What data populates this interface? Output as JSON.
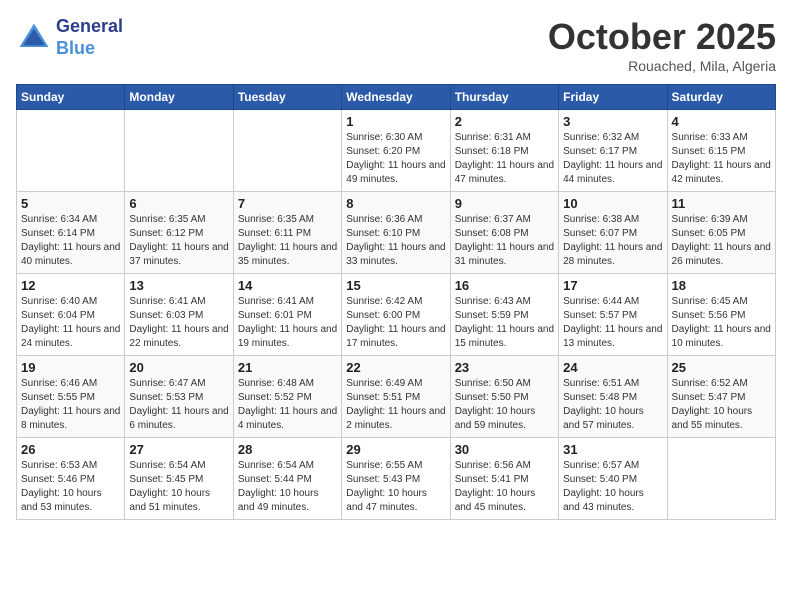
{
  "header": {
    "logo_line1": "General",
    "logo_line2": "Blue",
    "month": "October 2025",
    "location": "Rouached, Mila, Algeria"
  },
  "weekdays": [
    "Sunday",
    "Monday",
    "Tuesday",
    "Wednesday",
    "Thursday",
    "Friday",
    "Saturday"
  ],
  "weeks": [
    [
      {
        "day": "",
        "info": ""
      },
      {
        "day": "",
        "info": ""
      },
      {
        "day": "",
        "info": ""
      },
      {
        "day": "1",
        "info": "Sunrise: 6:30 AM\nSunset: 6:20 PM\nDaylight: 11 hours\nand 49 minutes."
      },
      {
        "day": "2",
        "info": "Sunrise: 6:31 AM\nSunset: 6:18 PM\nDaylight: 11 hours\nand 47 minutes."
      },
      {
        "day": "3",
        "info": "Sunrise: 6:32 AM\nSunset: 6:17 PM\nDaylight: 11 hours\nand 44 minutes."
      },
      {
        "day": "4",
        "info": "Sunrise: 6:33 AM\nSunset: 6:15 PM\nDaylight: 11 hours\nand 42 minutes."
      }
    ],
    [
      {
        "day": "5",
        "info": "Sunrise: 6:34 AM\nSunset: 6:14 PM\nDaylight: 11 hours\nand 40 minutes."
      },
      {
        "day": "6",
        "info": "Sunrise: 6:35 AM\nSunset: 6:12 PM\nDaylight: 11 hours\nand 37 minutes."
      },
      {
        "day": "7",
        "info": "Sunrise: 6:35 AM\nSunset: 6:11 PM\nDaylight: 11 hours\nand 35 minutes."
      },
      {
        "day": "8",
        "info": "Sunrise: 6:36 AM\nSunset: 6:10 PM\nDaylight: 11 hours\nand 33 minutes."
      },
      {
        "day": "9",
        "info": "Sunrise: 6:37 AM\nSunset: 6:08 PM\nDaylight: 11 hours\nand 31 minutes."
      },
      {
        "day": "10",
        "info": "Sunrise: 6:38 AM\nSunset: 6:07 PM\nDaylight: 11 hours\nand 28 minutes."
      },
      {
        "day": "11",
        "info": "Sunrise: 6:39 AM\nSunset: 6:05 PM\nDaylight: 11 hours\nand 26 minutes."
      }
    ],
    [
      {
        "day": "12",
        "info": "Sunrise: 6:40 AM\nSunset: 6:04 PM\nDaylight: 11 hours\nand 24 minutes."
      },
      {
        "day": "13",
        "info": "Sunrise: 6:41 AM\nSunset: 6:03 PM\nDaylight: 11 hours\nand 22 minutes."
      },
      {
        "day": "14",
        "info": "Sunrise: 6:41 AM\nSunset: 6:01 PM\nDaylight: 11 hours\nand 19 minutes."
      },
      {
        "day": "15",
        "info": "Sunrise: 6:42 AM\nSunset: 6:00 PM\nDaylight: 11 hours\nand 17 minutes."
      },
      {
        "day": "16",
        "info": "Sunrise: 6:43 AM\nSunset: 5:59 PM\nDaylight: 11 hours\nand 15 minutes."
      },
      {
        "day": "17",
        "info": "Sunrise: 6:44 AM\nSunset: 5:57 PM\nDaylight: 11 hours\nand 13 minutes."
      },
      {
        "day": "18",
        "info": "Sunrise: 6:45 AM\nSunset: 5:56 PM\nDaylight: 11 hours\nand 10 minutes."
      }
    ],
    [
      {
        "day": "19",
        "info": "Sunrise: 6:46 AM\nSunset: 5:55 PM\nDaylight: 11 hours\nand 8 minutes."
      },
      {
        "day": "20",
        "info": "Sunrise: 6:47 AM\nSunset: 5:53 PM\nDaylight: 11 hours\nand 6 minutes."
      },
      {
        "day": "21",
        "info": "Sunrise: 6:48 AM\nSunset: 5:52 PM\nDaylight: 11 hours\nand 4 minutes."
      },
      {
        "day": "22",
        "info": "Sunrise: 6:49 AM\nSunset: 5:51 PM\nDaylight: 11 hours\nand 2 minutes."
      },
      {
        "day": "23",
        "info": "Sunrise: 6:50 AM\nSunset: 5:50 PM\nDaylight: 10 hours\nand 59 minutes."
      },
      {
        "day": "24",
        "info": "Sunrise: 6:51 AM\nSunset: 5:48 PM\nDaylight: 10 hours\nand 57 minutes."
      },
      {
        "day": "25",
        "info": "Sunrise: 6:52 AM\nSunset: 5:47 PM\nDaylight: 10 hours\nand 55 minutes."
      }
    ],
    [
      {
        "day": "26",
        "info": "Sunrise: 6:53 AM\nSunset: 5:46 PM\nDaylight: 10 hours\nand 53 minutes."
      },
      {
        "day": "27",
        "info": "Sunrise: 6:54 AM\nSunset: 5:45 PM\nDaylight: 10 hours\nand 51 minutes."
      },
      {
        "day": "28",
        "info": "Sunrise: 6:54 AM\nSunset: 5:44 PM\nDaylight: 10 hours\nand 49 minutes."
      },
      {
        "day": "29",
        "info": "Sunrise: 6:55 AM\nSunset: 5:43 PM\nDaylight: 10 hours\nand 47 minutes."
      },
      {
        "day": "30",
        "info": "Sunrise: 6:56 AM\nSunset: 5:41 PM\nDaylight: 10 hours\nand 45 minutes."
      },
      {
        "day": "31",
        "info": "Sunrise: 6:57 AM\nSunset: 5:40 PM\nDaylight: 10 hours\nand 43 minutes."
      },
      {
        "day": "",
        "info": ""
      }
    ]
  ]
}
